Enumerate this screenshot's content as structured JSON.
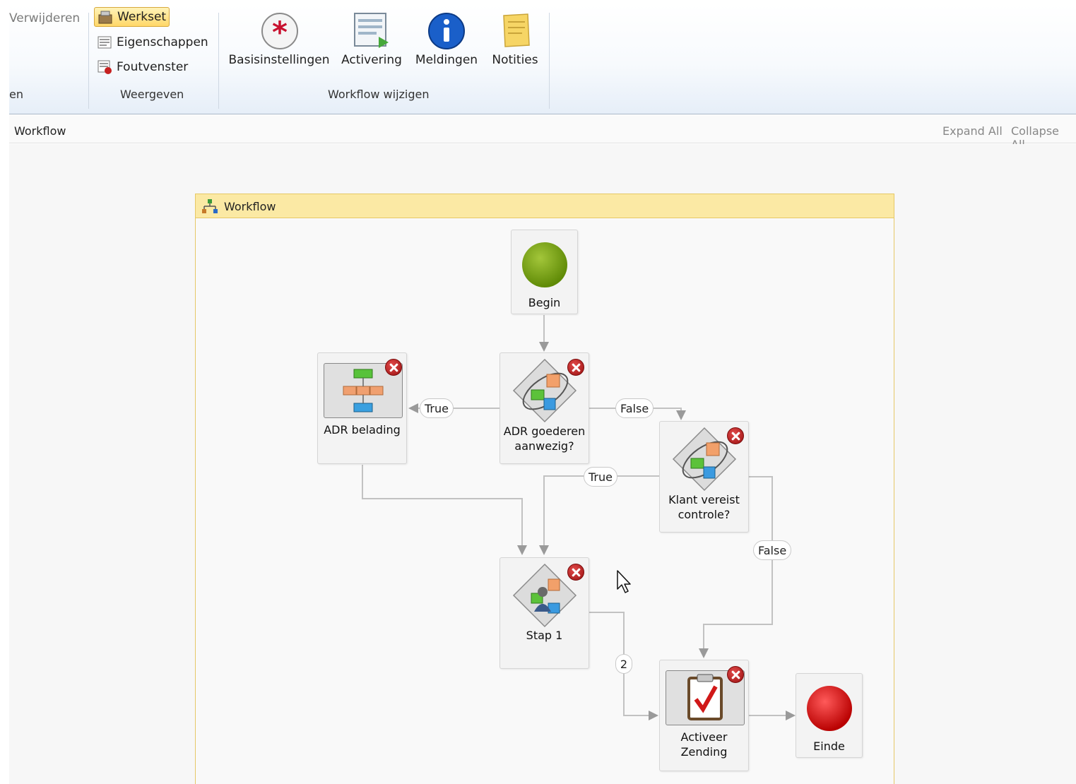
{
  "ribbon": {
    "left_group": {
      "delete_label": "Verwijderen",
      "group_label_partial": "en"
    },
    "view_group": {
      "label": "Weergeven",
      "items": [
        {
          "label": "Werkset",
          "icon": "toolbox-icon",
          "active": true
        },
        {
          "label": "Eigenschappen",
          "icon": "properties-icon"
        },
        {
          "label": "Foutvenster",
          "icon": "error-window-icon"
        }
      ]
    },
    "workflow_group": {
      "label": "Workflow wijzigen",
      "items": [
        {
          "label": "Basisinstellingen",
          "icon": "asterisk-icon"
        },
        {
          "label": "Activering",
          "icon": "activation-icon"
        },
        {
          "label": "Meldingen",
          "icon": "info-icon"
        },
        {
          "label": "Notities",
          "icon": "notes-icon"
        }
      ]
    }
  },
  "breadcrumb": {
    "title": "Workflow",
    "expand_all": "Expand All",
    "collapse_all": "Collapse All"
  },
  "workflow": {
    "title": "Workflow",
    "nodes": {
      "begin": "Begin",
      "adr_belading": "ADR belading",
      "adr_goederen_line1": "ADR goederen",
      "adr_goederen_line2": "aanwezig?",
      "klant_line1": "Klant vereist",
      "klant_line2": "controle?",
      "stap1": "Stap 1",
      "activeer_line1": "Activeer",
      "activeer_line2": "Zending",
      "einde": "Einde"
    },
    "branches": {
      "adr_true": "True",
      "adr_false": "False",
      "klant_true": "True",
      "klant_false": "False",
      "stap_count": "2"
    }
  },
  "colors": {
    "begin": "#7aa10e",
    "end": "#e01010",
    "error_badge": "#b01818",
    "container_header": "#fbe9a4"
  }
}
